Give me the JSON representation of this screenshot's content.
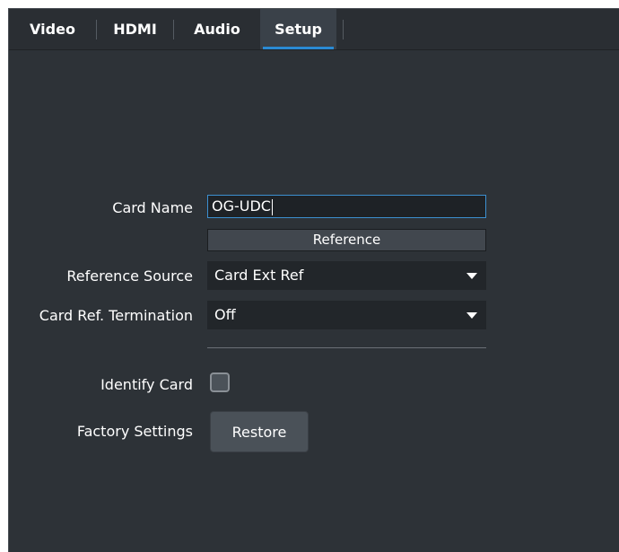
{
  "tabs": [
    {
      "label": "Video",
      "active": false
    },
    {
      "label": "HDMI",
      "active": false
    },
    {
      "label": "Audio",
      "active": false
    },
    {
      "label": "Setup",
      "active": true
    }
  ],
  "form": {
    "card_name": {
      "label": "Card Name",
      "value": "OG-UDC"
    },
    "reference_section": {
      "title": "Reference"
    },
    "reference_source": {
      "label": "Reference Source",
      "value": "Card Ext Ref"
    },
    "card_ref_termination": {
      "label": "Card Ref. Termination",
      "value": "Off"
    },
    "identify_card": {
      "label": "Identify Card",
      "checked": false
    },
    "factory_settings": {
      "label": "Factory Settings",
      "button_label": "Restore"
    }
  },
  "colors": {
    "panel_bg": "#2d3237",
    "tab_active_bg": "#3a4149",
    "tab_active_underline": "#2a8ad4",
    "input_focus_border": "#3c8fd0"
  }
}
